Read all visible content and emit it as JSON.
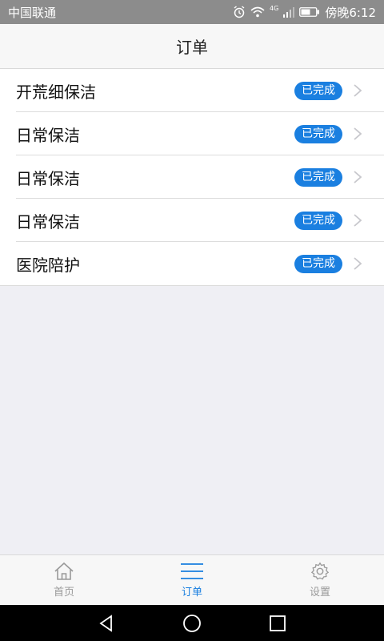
{
  "status_bar": {
    "carrier": "中国联通",
    "network": "4G",
    "time": "傍晚6:12"
  },
  "header": {
    "title": "订单"
  },
  "orders": [
    {
      "name": "开荒细保洁",
      "status": "已完成"
    },
    {
      "name": "日常保洁",
      "status": "已完成"
    },
    {
      "name": "日常保洁",
      "status": "已完成"
    },
    {
      "name": "日常保洁",
      "status": "已完成"
    },
    {
      "name": "医院陪护",
      "status": "已完成"
    }
  ],
  "tabs": [
    {
      "label": "首页",
      "icon": "home-icon",
      "active": false
    },
    {
      "label": "订单",
      "icon": "list-icon",
      "active": true
    },
    {
      "label": "设置",
      "icon": "gear-icon",
      "active": false
    }
  ],
  "colors": {
    "accent": "#1a7fe0",
    "inactive": "#9a9a9a",
    "status_bar": "#8c8c8c"
  }
}
